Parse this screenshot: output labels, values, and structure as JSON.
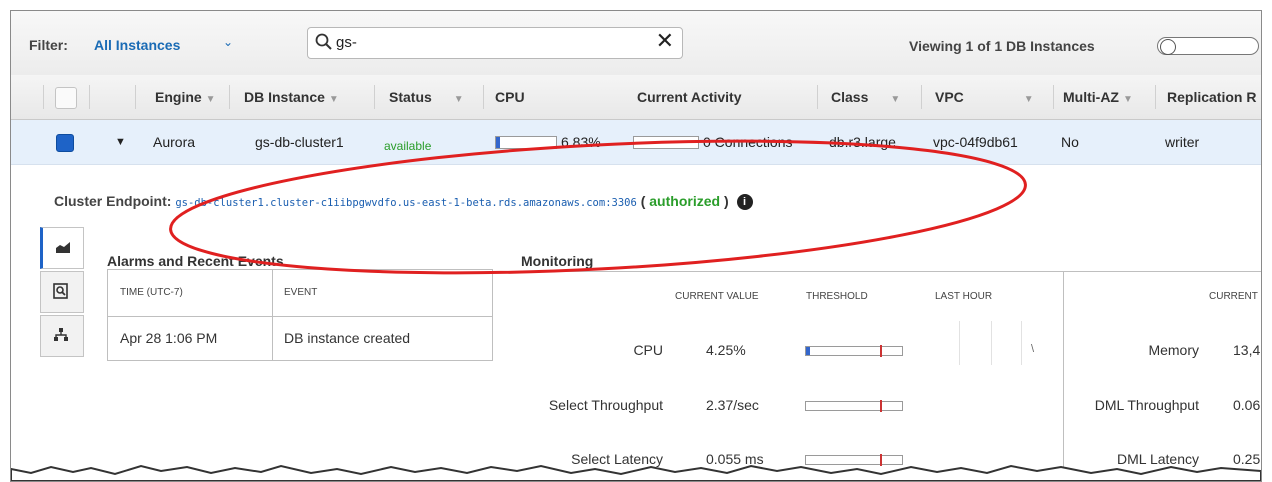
{
  "filter": {
    "label": "Filter:",
    "value": "All Instances",
    "search_value": "gs-",
    "viewing_text": "Viewing 1 of 1 DB Instances"
  },
  "columns": [
    "Engine",
    "DB Instance",
    "Status",
    "CPU",
    "Current Activity",
    "Class",
    "VPC",
    "Multi-AZ",
    "Replication R"
  ],
  "instance": {
    "engine": "Aurora",
    "db_instance": "gs-db-cluster1",
    "status": "available",
    "cpu": "6.83%",
    "cpu_fraction": 0.07,
    "activity": "0 Connections",
    "class": "db.r3.large",
    "vpc": "vpc-04f9db61",
    "multi_az": "No",
    "replication_role": "writer"
  },
  "endpoint": {
    "label": "Cluster Endpoint:",
    "value": "gs-db-cluster1.cluster-c1iibpgwvdfo.us-east-1-beta.rds.amazonaws.com:3306",
    "open_paren": "(",
    "status": "authorized",
    "close_paren": ")"
  },
  "alarms": {
    "title": "Alarms and Recent Events",
    "headers": [
      "TIME (UTC-7)",
      "EVENT"
    ],
    "rows": [
      {
        "time": "Apr 28 1:06 PM",
        "event": "DB instance created"
      }
    ]
  },
  "monitoring": {
    "title": "Monitoring",
    "headers": [
      "CURRENT VALUE",
      "THRESHOLD",
      "LAST HOUR"
    ],
    "right_header": "CURRENT",
    "left_metrics": [
      {
        "label": "CPU",
        "value": "4.25%",
        "fraction": 0.04
      },
      {
        "label": "Select Throughput",
        "value": "2.37/sec",
        "fraction": 0
      },
      {
        "label": "Select Latency",
        "value": "0.055 ms",
        "fraction": 0
      }
    ],
    "right_metrics": [
      {
        "label": "Memory",
        "value": "13,4"
      },
      {
        "label": "DML Throughput",
        "value": "0.06"
      },
      {
        "label": "DML Latency",
        "value": "0.25"
      }
    ]
  },
  "colors": {
    "accent": "#1e63c7",
    "link": "#1a6bb5",
    "ok": "#2a9d2a",
    "annotation": "#e02020"
  }
}
